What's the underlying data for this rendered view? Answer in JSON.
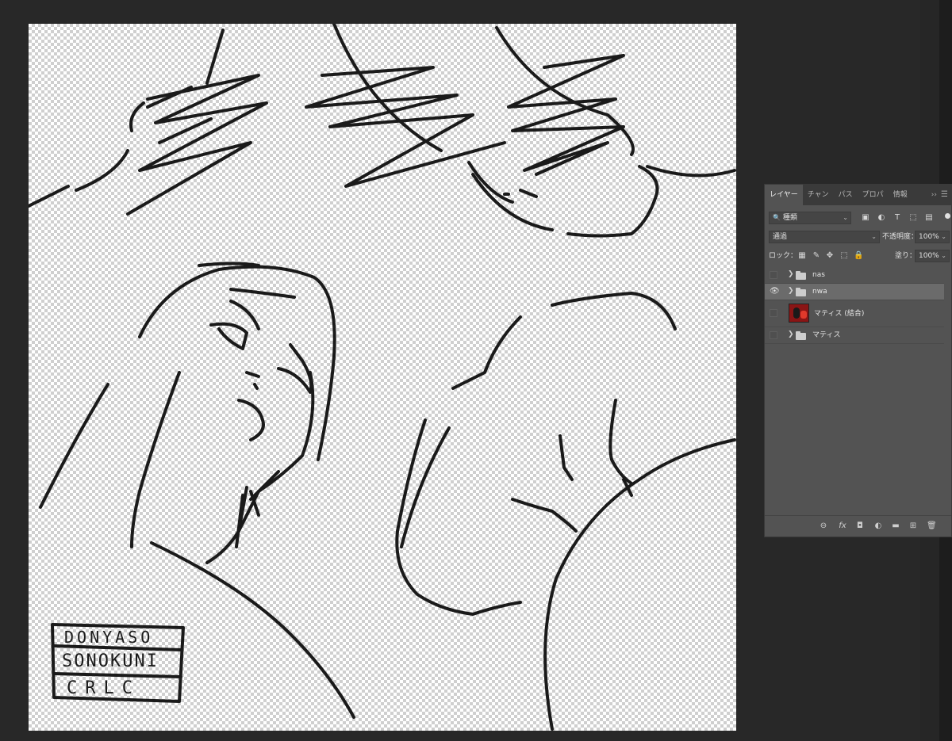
{
  "panel": {
    "tabs": [
      "レイヤー",
      "チャン",
      "パス",
      "プロパ",
      "情報"
    ],
    "tabs_more": "››",
    "filter": {
      "value": "種類"
    },
    "blend_mode": "通過",
    "opacity_label": "不透明度：",
    "opacity_value": "100%",
    "lock_label": "ロック：",
    "fill_label": "塗り：",
    "fill_value": "100%",
    "layers": [
      {
        "name": "nas",
        "type": "group",
        "visible": false,
        "selected": false
      },
      {
        "name": "nwa",
        "type": "group",
        "visible": true,
        "selected": true
      },
      {
        "name": "マティス (結合)",
        "type": "image",
        "visible": false,
        "selected": false
      },
      {
        "name": "マティス",
        "type": "group",
        "visible": false,
        "selected": false
      }
    ]
  },
  "canvas": {
    "stamp_lines": [
      "DONYASO",
      "SONOKUNI",
      "CRLC"
    ]
  },
  "colors": {
    "workspace_bg": "#282828",
    "panel_bg": "#535353",
    "selected_layer_bg": "#6b6b6b",
    "ink": "#1a1a1a"
  }
}
